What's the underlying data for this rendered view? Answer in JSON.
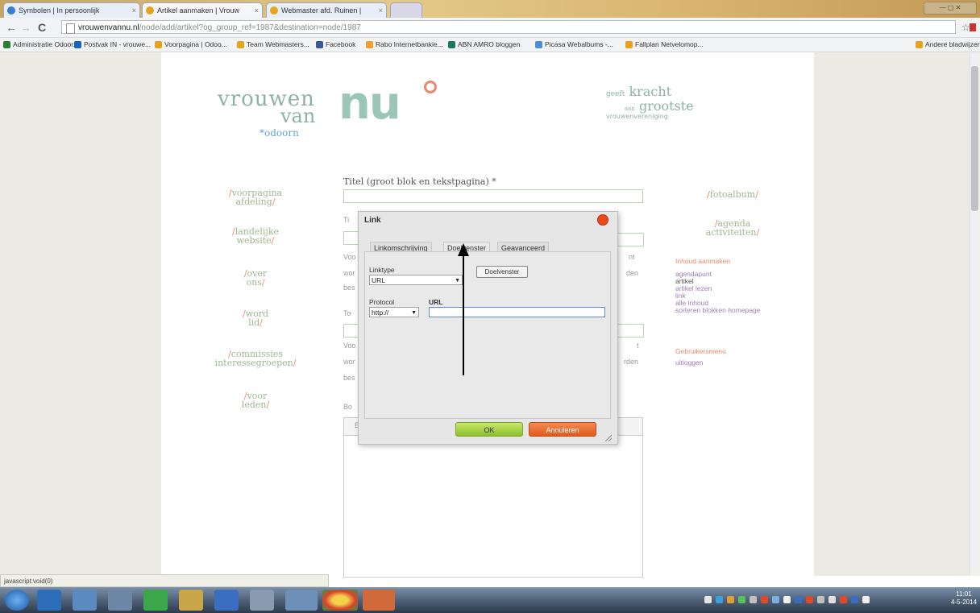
{
  "browser": {
    "tabs": [
      {
        "label": "Symbolen | In persoonlijk"
      },
      {
        "label": "Artikel aanmaken | Vrouw"
      },
      {
        "label": "Webmaster afd. Ruinen |"
      }
    ],
    "url": {
      "host": "vrouwenvannu.nl",
      "path": "/node/add/artikel?og_group_ref=1987&destination=node/1987"
    },
    "bookmarks": [
      {
        "label": "Administratie Odoor...",
        "color": "#2e7d32"
      },
      {
        "label": "Postvak IN - vrouwe...",
        "color": "#1565c0"
      },
      {
        "label": "Voorpagina | Odoo...",
        "color": "#e8a31c"
      },
      {
        "label": "Team Webmasters...",
        "color": "#e8a31c"
      },
      {
        "label": "Facebook",
        "color": "#3b5998"
      },
      {
        "label": "Rabo Internetbankie...",
        "color": "#f0a030"
      },
      {
        "label": "ABN AMRO bloggen",
        "color": "#1b7a5a"
      },
      {
        "label": "Picasa Webalbums -...",
        "color": "#4c8ed9"
      },
      {
        "label": "Fallplan Netvelomop...",
        "color": "#e8a31c"
      }
    ],
    "more_bookmarks": "Andere bladwijzers"
  },
  "site": {
    "logo_main": "vrouwen",
    "logo_van": "van",
    "logo_nu": "nu",
    "logo_place": "*odoorn",
    "slogan_small": "geeft",
    "slogan_kracht": "kracht",
    "slogan_aan": "aan",
    "slogan_grootste": "grootste",
    "slogan_sub": "vrouwenvereniging",
    "left_nav": [
      {
        "line1": "voorpagina",
        "line2": "afdeling"
      },
      {
        "line1": "landelijke",
        "line2": "website"
      },
      {
        "line1": "over",
        "line2": "ons"
      },
      {
        "line1": "word",
        "line2": "lid"
      },
      {
        "line1": "commissies",
        "line2": "interessegroepen"
      },
      {
        "line1": "voor",
        "line2": "leden"
      }
    ],
    "right_nav": [
      {
        "line1": "fotoalbum",
        "line2": ""
      },
      {
        "line1": "agenda",
        "line2": "activiteiten"
      }
    ],
    "right_links_title": "Inhoud aanmaken",
    "right_links": [
      "agendapunt",
      "artikel",
      "artikel lezen",
      "link",
      "alle inhoud",
      "sorteren blokken homepage"
    ],
    "right_links_2": [
      "Gebruikersmenu",
      "uitloggen"
    ]
  },
  "form": {
    "title_label": "Titel (groot blok en tekstpagina) *",
    "frag_title_2": "Ti",
    "frag_title_3": "To",
    "frag_body": "Bo",
    "frag_voo": "Voo",
    "frag_wor": "wor",
    "frag_bes": "bes",
    "frag_nt": "nt",
    "frag_den": "den",
    "frag_t": "t",
    "frag_rden": "rden",
    "frag_b": "B"
  },
  "dialog": {
    "title": "Link",
    "tabs": [
      "Linkomschrijving",
      "Doelvenster",
      "Geavanceerd"
    ],
    "linktype_label": "Linktype",
    "linktype_value": "URL",
    "browse_button": "Doelvenster",
    "protocol_label": "Protocol",
    "protocol_value": "http://",
    "url_label": "URL",
    "url_value": "",
    "ok": "OK",
    "cancel": "Annuleren"
  },
  "status_text": "javascript:void(0)",
  "clock": {
    "time": "11:01",
    "date": "4-5-2014"
  },
  "window_controls": "— ▢ ✕"
}
